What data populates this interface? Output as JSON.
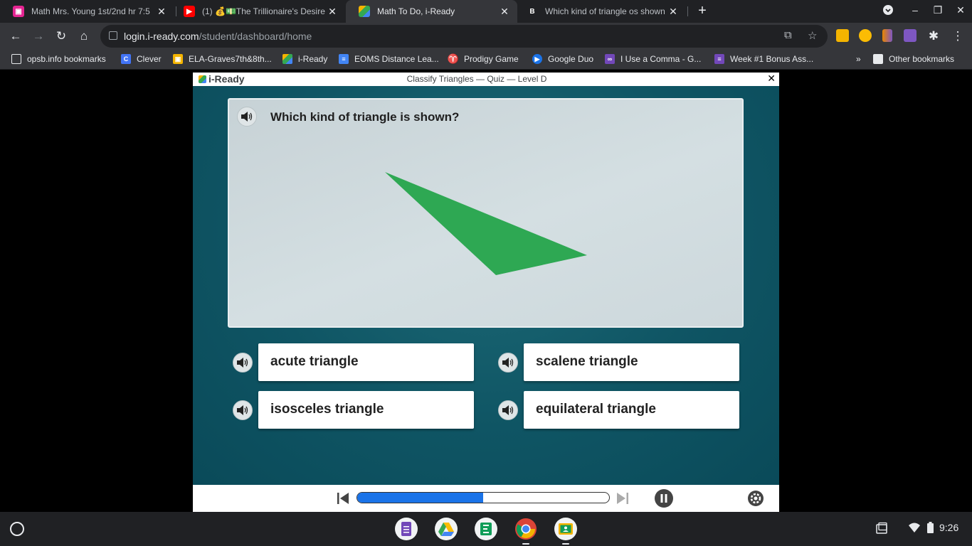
{
  "browser": {
    "tabs": [
      {
        "title": "Math Mrs. Young 1st/2nd hr 7:5",
        "favicon": "classroom-icon",
        "color": "#e52592",
        "active": false
      },
      {
        "title": "(1) 💰💵The Trillionaire's Desire",
        "favicon": "youtube-icon",
        "color": "#ff0000",
        "active": false
      },
      {
        "title": "Math To Do, i-Ready",
        "favicon": "iready-icon",
        "color": "#34a853",
        "active": true
      },
      {
        "title": "Which kind of triangle os shown",
        "favicon": "brainly-icon",
        "color": "#202124",
        "active": false
      }
    ],
    "url_host": "login.i-ready.com",
    "url_path": "/student/dashboard/home",
    "bookmarks": [
      {
        "label": "opsb.info bookmarks",
        "icon": "folder-icon"
      },
      {
        "label": "Clever",
        "icon": "clever-icon"
      },
      {
        "label": "ELA-Graves7th&8th...",
        "icon": "classroom-icon"
      },
      {
        "label": "i-Ready",
        "icon": "iready-icon"
      },
      {
        "label": "EOMS Distance Lea...",
        "icon": "docs-icon"
      },
      {
        "label": "Prodigy Game",
        "icon": "prodigy-icon"
      },
      {
        "label": "Google Duo",
        "icon": "duo-icon"
      },
      {
        "label": "I Use a Comma - G...",
        "icon": "comma-icon"
      },
      {
        "label": "Week #1 Bonus Ass...",
        "icon": "forms-icon"
      }
    ],
    "other_bookmarks": "Other bookmarks",
    "more_chevron": "»"
  },
  "lesson": {
    "logo": "i-Ready",
    "title": "Classify Triangles — Quiz — Level D",
    "close": "✕",
    "question": "Which kind of triangle is shown?",
    "answers": [
      {
        "label": "acute triangle"
      },
      {
        "label": "scalene triangle"
      },
      {
        "label": "isosceles triangle"
      },
      {
        "label": "equilateral triangle"
      }
    ],
    "triangle_color": "#2ea853",
    "progress_fraction": 0.5
  },
  "shelf": {
    "apps": [
      {
        "name": "google-forms-icon",
        "color": "#7248b9"
      },
      {
        "name": "google-drive-icon",
        "color": "#f1f3f4"
      },
      {
        "name": "google-classroom-green-icon",
        "color": "#0f9d58"
      },
      {
        "name": "chrome-icon",
        "color": "#e8eaed"
      },
      {
        "name": "google-classroom-icon",
        "color": "#f4b400"
      }
    ],
    "time": "9:26"
  }
}
